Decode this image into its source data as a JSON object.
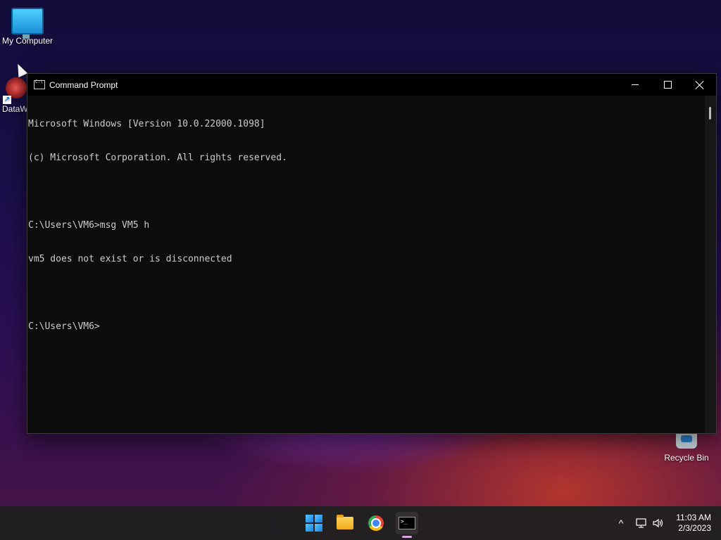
{
  "desktop": {
    "icons": [
      {
        "label": "My Computer"
      },
      {
        "label": "DataW"
      },
      {
        "label": "Recycle Bin"
      }
    ]
  },
  "window": {
    "title": "Command Prompt",
    "console_lines": [
      "Microsoft Windows [Version 10.0.22000.1098]",
      "(c) Microsoft Corporation. All rights reserved.",
      "",
      "C:\\Users\\VM6>msg VM5 h",
      "vm5 does not exist or is disconnected",
      "",
      "C:\\Users\\VM6>"
    ],
    "controls": {
      "minimize": "minimize-icon",
      "maximize": "maximize-icon",
      "close": "close-icon"
    }
  },
  "taskbar": {
    "apps": [
      {
        "name": "start",
        "icon": "windows-logo-icon"
      },
      {
        "name": "file-explorer",
        "icon": "folder-icon"
      },
      {
        "name": "chrome",
        "icon": "chrome-icon"
      },
      {
        "name": "command-prompt",
        "icon": "terminal-icon",
        "active": true
      }
    ],
    "tray": {
      "chevron": "^",
      "network": "network-icon",
      "volume": "volume-icon"
    },
    "clock": {
      "time": "11:03 AM",
      "date": "2/3/2023"
    }
  }
}
